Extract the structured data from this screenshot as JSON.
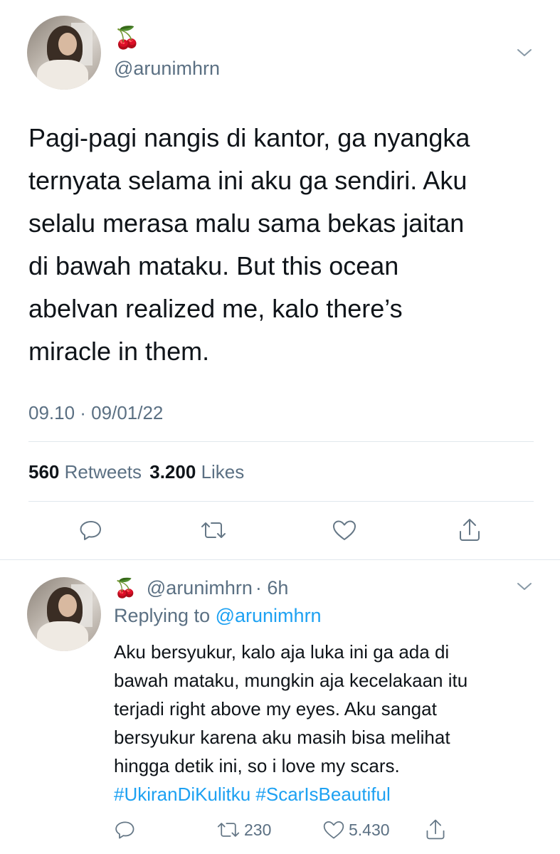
{
  "main_tweet": {
    "emoji": "🍒",
    "handle": "@arunimhrn",
    "text_lines": [
      "Pagi-pagi nangis di kantor, ga nyangka",
      "ternyata selama ini aku ga sendiri. Aku",
      "selalu merasa malu sama bekas jaitan",
      "di bawah mataku. But this ocean",
      "abelvan realized me, kalo there’s",
      "miracle in them."
    ],
    "timestamp": "09.10 · 09/01/22",
    "retweets_count": "560",
    "retweets_label": "Retweets",
    "likes_count": "3.200",
    "likes_label": "Likes"
  },
  "reply": {
    "emoji": "🍒",
    "handle": "@arunimhrn",
    "time": "· 6h",
    "replying_prefix": "Replying to",
    "replying_to": "@arunimhrn",
    "text_lines": [
      "Aku bersyukur, kalo aja luka ini ga ada di",
      "bawah mataku, mungkin aja kecelakaan itu",
      "terjadi right above my eyes. Aku sangat",
      "bersyukur karena aku masih bisa melihat",
      "hingga detik ini, so i love my scars."
    ],
    "hashtags": "#UkiranDiKulitku #ScarIsBeautiful",
    "retweet_count": "230",
    "like_count": "5.430"
  },
  "colors": {
    "accent": "#1da1f2",
    "secondary_text": "#5b7083",
    "divider": "#e1e8ed"
  }
}
